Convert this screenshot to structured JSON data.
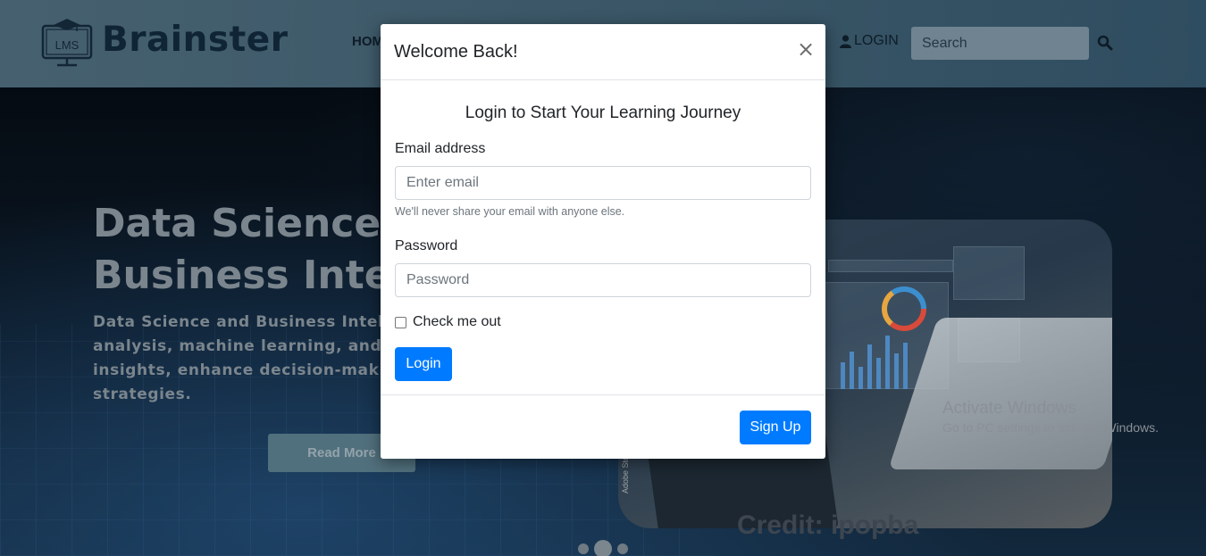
{
  "brand": {
    "name": "Brainster",
    "logo_caption": "LMS"
  },
  "nav": {
    "home_label": "HOM",
    "login_label": "LOGIN",
    "search_placeholder": "Search"
  },
  "hero": {
    "title_line1": "Data Science A",
    "title_line2": "Business Intelli",
    "text_line1": "Data Science and Business Intelliger",
    "text_line2": "analysis, machine learning, and visua",
    "text_line3": "insights, enhance decision-making, a",
    "text_line4": "strategies.",
    "read_more_label": "Read More",
    "image_credit": "Credit: ipopba",
    "stock_label": "Adobe Stock | #"
  },
  "carousel": {
    "slide_count": 3,
    "active_index": 1
  },
  "os_overlay": {
    "title": "Activate Windows",
    "subtitle": "Go to PC settings to activate Windows."
  },
  "modal": {
    "title": "Welcome Back!",
    "close_symbol": "×",
    "subtitle": "Login to Start Your Learning Journey",
    "email_label": "Email address",
    "email_placeholder": "Enter email",
    "email_help": "We'll never share your email with anyone else.",
    "password_label": "Password",
    "password_placeholder": "Password",
    "remember_label": "Check me out",
    "remember_checked": false,
    "login_label": "Login",
    "signup_label": "Sign Up"
  },
  "colors": {
    "primary": "#007bff",
    "navbar": "#3c5868",
    "brand_text": "#0f2536"
  }
}
